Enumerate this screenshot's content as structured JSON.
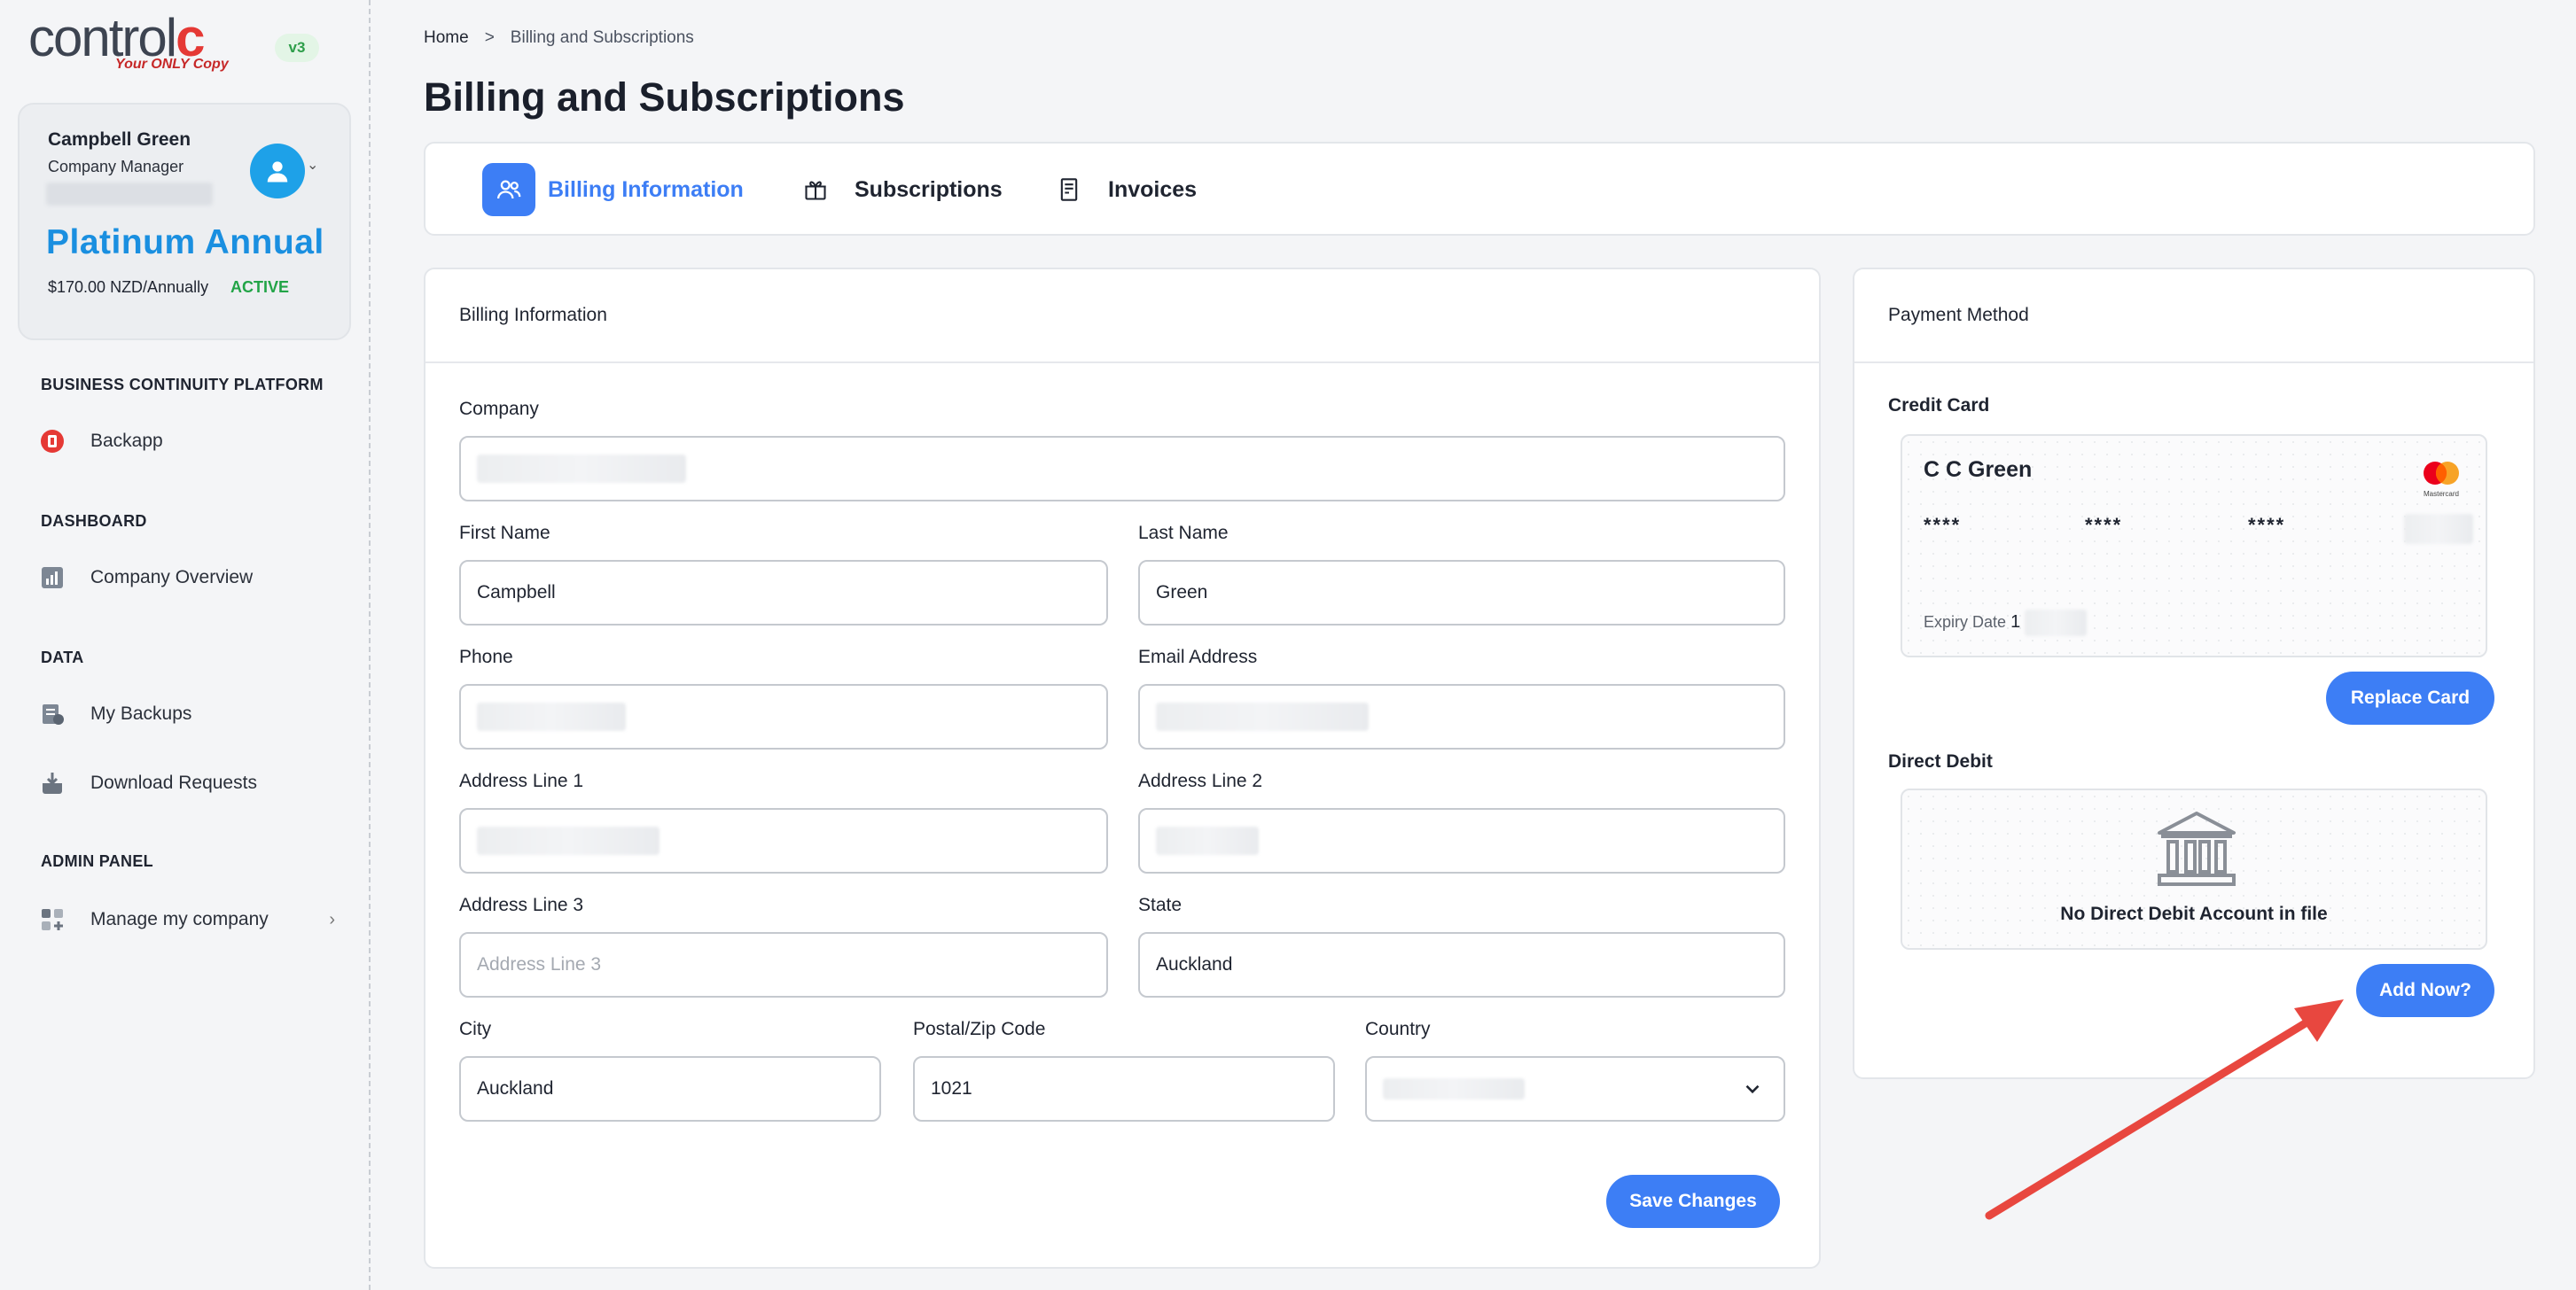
{
  "brand": {
    "logo_main": "control",
    "logo_c": "c",
    "tagline": "Your ONLY Copy",
    "version": "v3"
  },
  "profile": {
    "name": "Campbell Green",
    "role": "Company Manager",
    "plan_name": "Platinum Annual",
    "plan_price": "$170.00 NZD/Annually",
    "plan_status": "ACTIVE"
  },
  "sidebar": {
    "sections": [
      {
        "title": "BUSINESS CONTINUITY PLATFORM",
        "items": [
          {
            "label": "Backapp",
            "icon": "backapp-icon"
          }
        ]
      },
      {
        "title": "DASHBOARD",
        "items": [
          {
            "label": "Company Overview",
            "icon": "chart-icon"
          }
        ]
      },
      {
        "title": "DATA",
        "items": [
          {
            "label": "My Backups",
            "icon": "backups-icon"
          },
          {
            "label": "Download Requests",
            "icon": "download-icon"
          }
        ]
      },
      {
        "title": "ADMIN PANEL",
        "items": [
          {
            "label": "Manage my company",
            "icon": "grid-icon"
          }
        ]
      }
    ]
  },
  "breadcrumb": {
    "home": "Home",
    "separator": ">",
    "current": "Billing and Subscriptions"
  },
  "page_title": "Billing and Subscriptions",
  "tabs": [
    {
      "label": "Billing Information",
      "icon": "users-icon",
      "active": true
    },
    {
      "label": "Subscriptions",
      "icon": "gift-icon",
      "active": false
    },
    {
      "label": "Invoices",
      "icon": "receipt-icon",
      "active": false
    }
  ],
  "billing": {
    "header": "Billing Information",
    "labels": {
      "company": "Company",
      "first_name": "First Name",
      "last_name": "Last Name",
      "phone": "Phone",
      "email": "Email Address",
      "address1": "Address Line 1",
      "address2": "Address Line 2",
      "address3": "Address Line 3",
      "state": "State",
      "city": "City",
      "postal": "Postal/Zip Code",
      "country": "Country"
    },
    "values": {
      "first_name": "Campbell",
      "last_name": "Green",
      "state": "Auckland",
      "city": "Auckland",
      "postal": "1021"
    },
    "placeholders": {
      "address3": "Address Line 3"
    },
    "save_label": "Save Changes"
  },
  "payment": {
    "header": "Payment Method",
    "credit_card_title": "Credit Card",
    "card_name": "C C Green",
    "card_mask": [
      "****",
      "****",
      "****"
    ],
    "expiry_label": "Expiry Date",
    "expiry_value": "1",
    "card_brand": "Mastercard",
    "replace_label": "Replace Card",
    "direct_debit_title": "Direct Debit",
    "direct_debit_empty": "No Direct Debit Account in file",
    "add_label": "Add Now?"
  },
  "colors": {
    "accent": "#3d7ef5",
    "plan": "#1a8fe0",
    "active": "#22a447",
    "arrow": "#e8473f"
  }
}
